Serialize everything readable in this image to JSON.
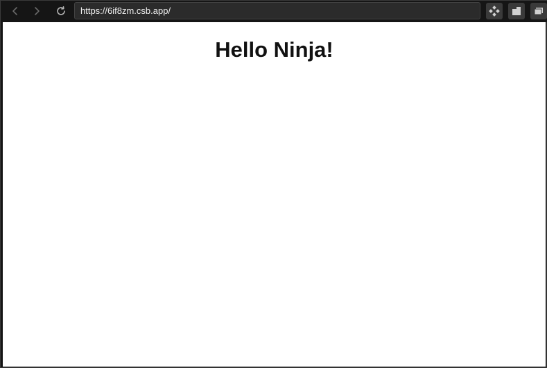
{
  "browser": {
    "url": "https://6if8zm.csb.app/",
    "icons": {
      "back": "chevron-left-icon",
      "forward": "chevron-right-icon",
      "reload": "reload-icon",
      "devtools": "devtools-icon",
      "split": "split-view-icon",
      "windows": "windows-icon"
    },
    "colors": {
      "chrome": "#151515",
      "url_bar": "#2b2b2b",
      "accent": "#2ea043"
    }
  },
  "page": {
    "heading": "Hello Ninja!"
  }
}
